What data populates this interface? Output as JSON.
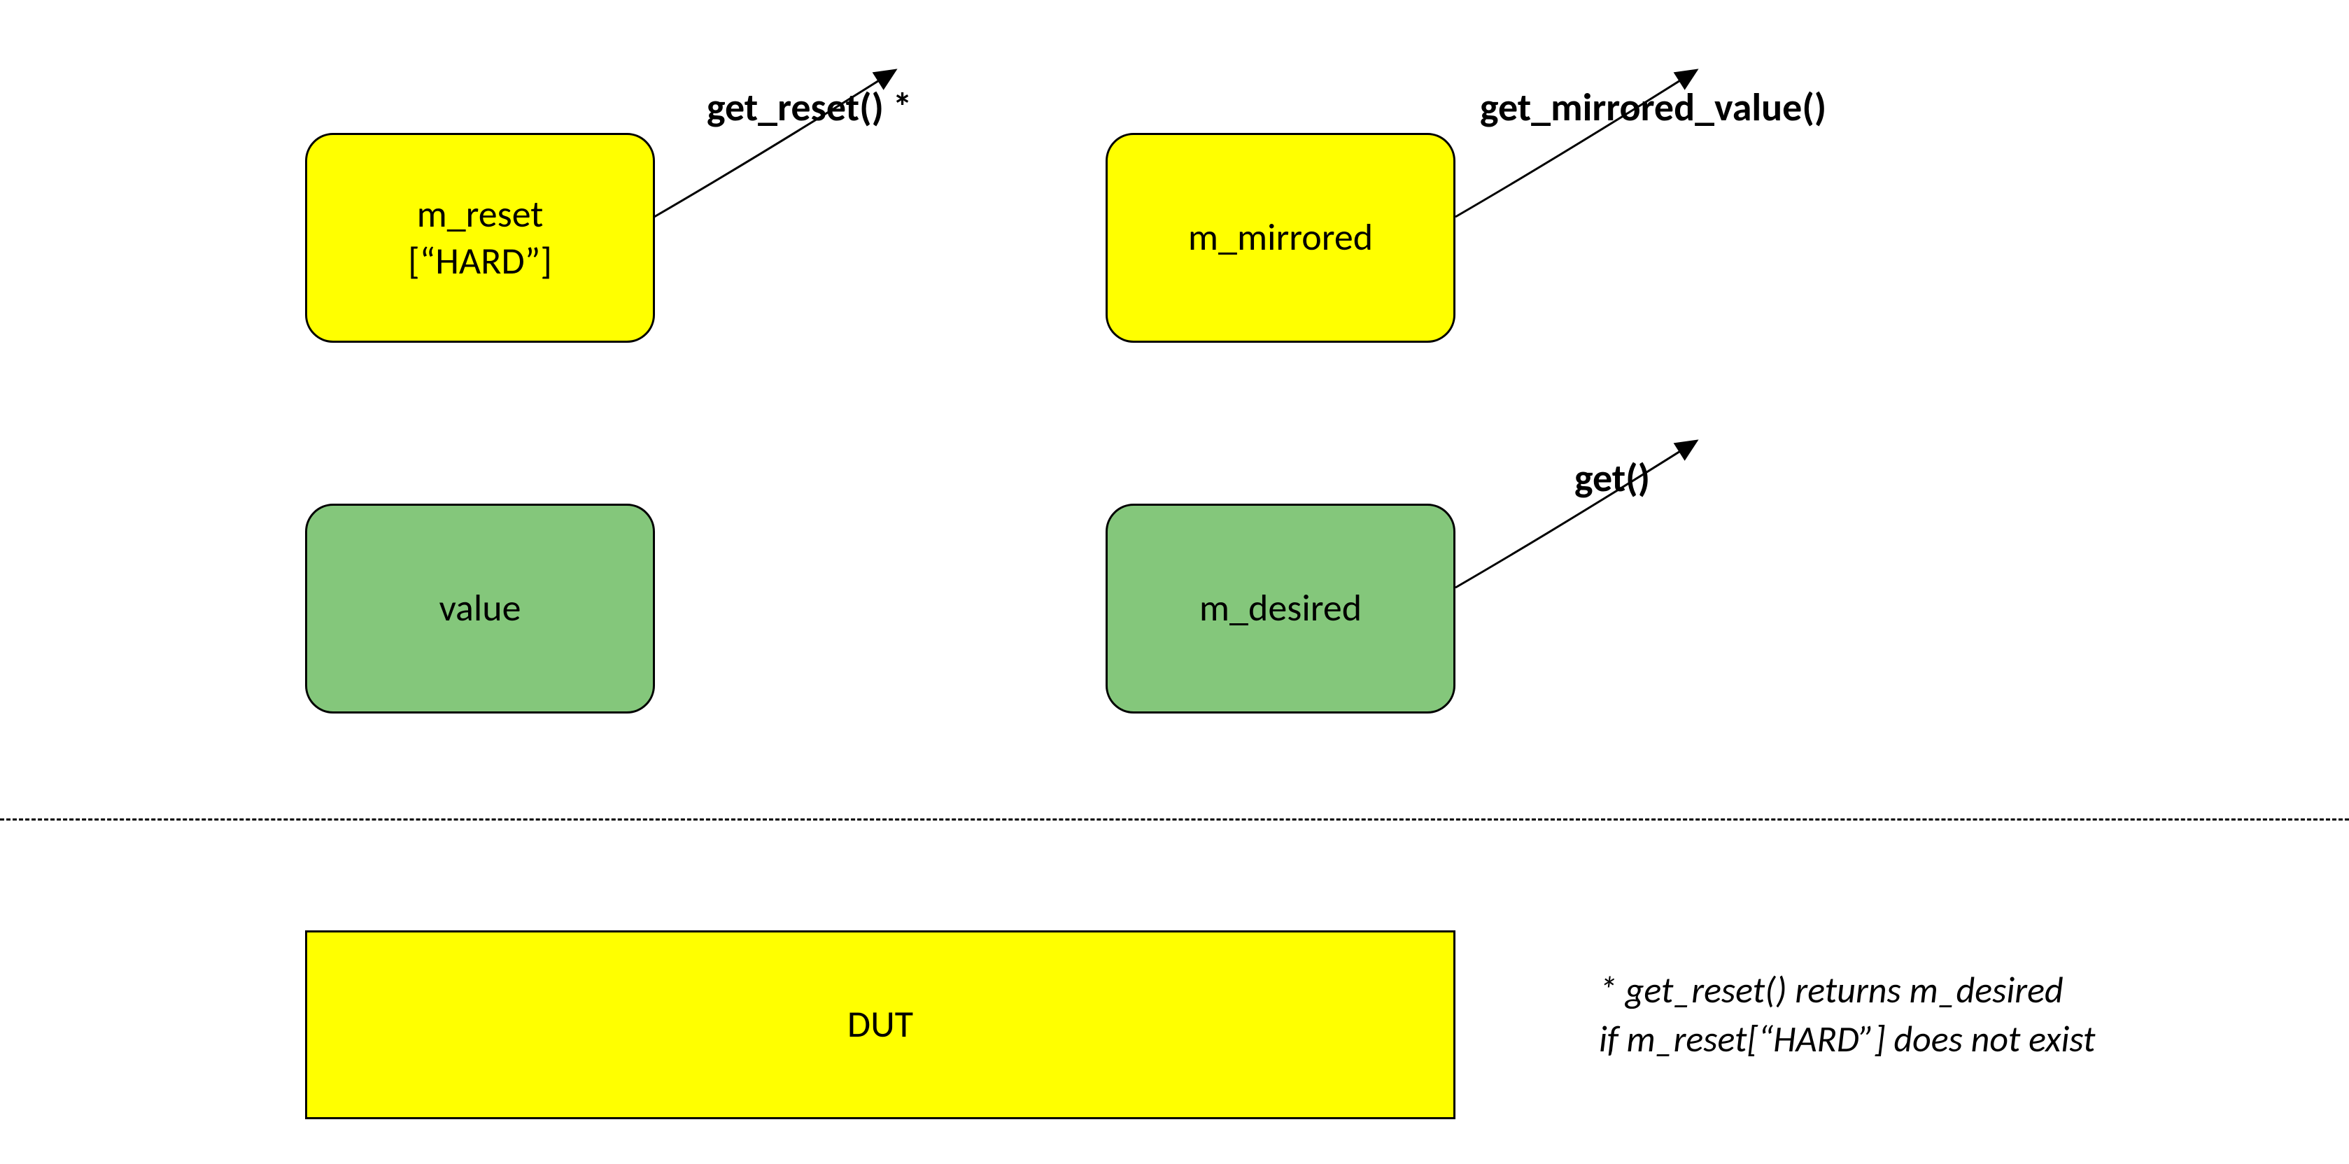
{
  "boxes": {
    "m_reset": {
      "label": "m_reset\n[“HARD”]"
    },
    "m_mirrored": {
      "label": "m_mirrored"
    },
    "value": {
      "label": "value"
    },
    "m_desired": {
      "label": "m_desired"
    },
    "dut": {
      "label": "DUT"
    }
  },
  "labels": {
    "get_reset": "get_reset() *",
    "get_mirrored_value": "get_mirrored_value()",
    "get": "get()"
  },
  "footnote": "* get_reset() returns m_desired\nif m_reset[“HARD”] does not exist",
  "colors": {
    "yellow": "#ffff00",
    "green": "#84c77b",
    "stroke": "#000000"
  }
}
